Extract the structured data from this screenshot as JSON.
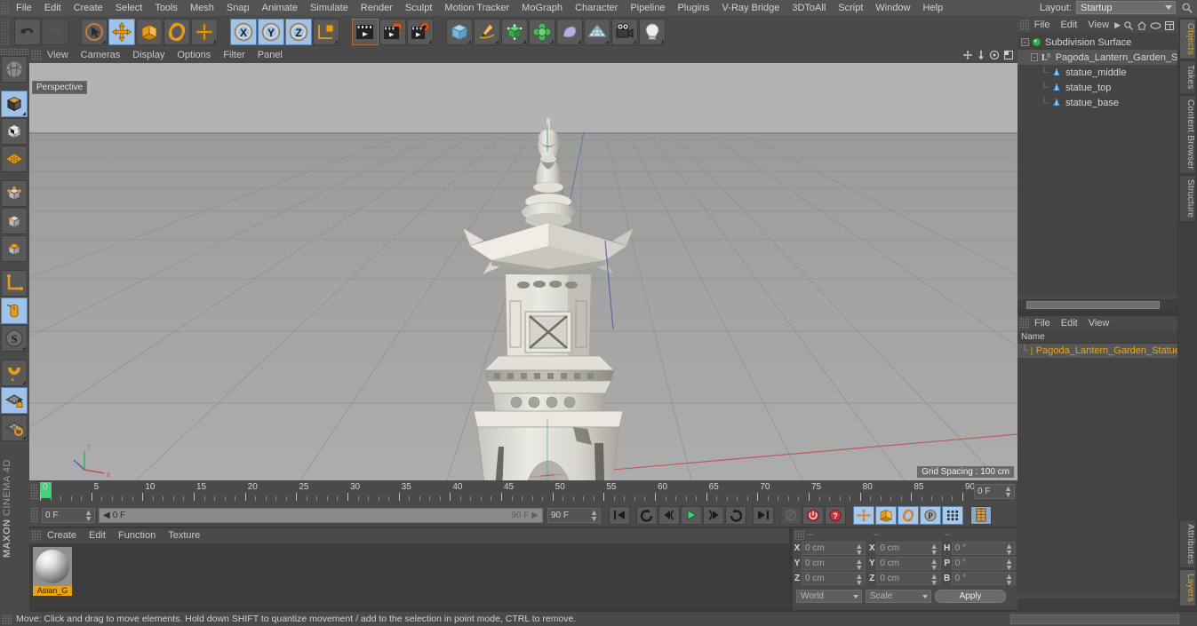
{
  "menubar": {
    "items": [
      "File",
      "Edit",
      "Create",
      "Select",
      "Tools",
      "Mesh",
      "Snap",
      "Animate",
      "Simulate",
      "Render",
      "Sculpt",
      "Motion Tracker",
      "MoGraph",
      "Character",
      "Pipeline",
      "Plugins",
      "V-Ray Bridge",
      "3DToAll",
      "Script",
      "Window",
      "Help"
    ],
    "layout_label": "Layout:",
    "layout_value": "Startup",
    "search_icon": "magnifier-icon"
  },
  "toolbar": {
    "groups": [
      {
        "name": "history",
        "buttons": [
          {
            "name": "undo-button",
            "icon": "undo-arrow-icon",
            "state": "normal"
          },
          {
            "name": "redo-button",
            "icon": "redo-arrow-icon",
            "state": "disabled"
          }
        ]
      },
      {
        "name": "tools",
        "buttons": [
          {
            "name": "live-selection-button",
            "icon": "cursor-circle-icon",
            "state": "normal"
          },
          {
            "name": "move-tool-button",
            "icon": "move-arrows-icon",
            "state": "selected"
          },
          {
            "name": "scale-tool-button",
            "icon": "scale-box-icon",
            "state": "normal"
          },
          {
            "name": "rotate-tool-button",
            "icon": "rotate-ring-icon",
            "state": "normal"
          },
          {
            "name": "transform-tool-button",
            "icon": "plus-cross-icon",
            "state": "normal"
          }
        ]
      },
      {
        "name": "axis-locks",
        "buttons": [
          {
            "name": "x-axis-lock-button",
            "icon": "x-axis-icon",
            "label": "X",
            "state": "selected"
          },
          {
            "name": "y-axis-lock-button",
            "icon": "y-axis-icon",
            "label": "Y",
            "state": "selected"
          },
          {
            "name": "z-axis-lock-button",
            "icon": "z-axis-icon",
            "label": "Z",
            "state": "selected"
          },
          {
            "name": "world-object-axis-button",
            "icon": "axis-cube-icon",
            "state": "normal"
          }
        ]
      },
      {
        "name": "render",
        "buttons": [
          {
            "name": "render-view-button",
            "icon": "clapper-render-icon",
            "state": "active-frame"
          },
          {
            "name": "render-region-button",
            "icon": "clapper-region-icon",
            "state": "normal"
          },
          {
            "name": "render-settings-button",
            "icon": "clapper-settings-icon",
            "state": "normal"
          }
        ]
      },
      {
        "name": "create",
        "buttons": [
          {
            "name": "add-cube-button",
            "icon": "cube-icon",
            "state": "normal"
          },
          {
            "name": "add-spline-button",
            "icon": "pen-spline-icon",
            "state": "normal"
          },
          {
            "name": "add-generator-button",
            "icon": "green-cube-generator-icon",
            "state": "normal"
          },
          {
            "name": "add-array-button",
            "icon": "green-cluster-icon",
            "state": "normal"
          },
          {
            "name": "add-deformer-button",
            "icon": "bend-deformer-icon",
            "state": "normal"
          },
          {
            "name": "add-environment-button",
            "icon": "floor-grid-icon",
            "state": "normal"
          },
          {
            "name": "add-camera-button",
            "icon": "camera-icon",
            "state": "normal"
          },
          {
            "name": "add-light-button",
            "icon": "light-bulb-icon",
            "state": "normal"
          }
        ]
      }
    ]
  },
  "left_toolbar": {
    "buttons": [
      {
        "name": "make-editable-button",
        "icon": "make-editable-icon",
        "state": "normal"
      },
      {
        "name": "model-mode-button",
        "icon": "model-cube-icon",
        "state": "selected"
      },
      {
        "name": "texture-mode-button",
        "icon": "texture-cube-icon",
        "state": "normal"
      },
      {
        "name": "workplane-mode-button",
        "icon": "workplane-grid-icon",
        "state": "normal"
      },
      {
        "name": "points-mode-button",
        "icon": "points-cube-icon",
        "state": "normal"
      },
      {
        "name": "edges-mode-button",
        "icon": "edges-cube-icon",
        "state": "normal"
      },
      {
        "name": "polygons-mode-button",
        "icon": "polygons-cube-icon",
        "state": "normal"
      },
      {
        "name": "object-axis-button",
        "icon": "axis-l-icon",
        "state": "normal"
      },
      {
        "name": "enable-axis-button",
        "icon": "mouse-axis-icon",
        "state": "selected"
      },
      {
        "name": "soft-selection-button",
        "icon": "s-circle-icon",
        "state": "normal"
      },
      {
        "name": "magnet-tool-button",
        "icon": "magnet-icon",
        "state": "normal"
      },
      {
        "name": "lock-workplane-button",
        "icon": "workplane-lock-icon",
        "state": "selected"
      },
      {
        "name": "workplane-rotate-button",
        "icon": "workplane-rotate-icon",
        "state": "normal"
      }
    ],
    "brand_line1": "MAXON",
    "brand_line2": "CINEMA 4D"
  },
  "viewport": {
    "menu_items": [
      "View",
      "Cameras",
      "Display",
      "Options",
      "Filter",
      "Panel"
    ],
    "corner_icons": [
      "pan-icon",
      "zoom-icon",
      "orbit-icon",
      "maximize-icon"
    ],
    "perspective_label": "Perspective",
    "grid_spacing_label": "Grid Spacing : 100 cm",
    "axis_gizmo": {
      "y_label": "Y",
      "x_label": "X"
    },
    "scene_subject": "pagoda lantern garden stone statue"
  },
  "timeline": {
    "tick_labels": [
      "0",
      "5",
      "10",
      "15",
      "20",
      "25",
      "30",
      "35",
      "40",
      "45",
      "50",
      "55",
      "60",
      "65",
      "70",
      "75",
      "80",
      "85",
      "90"
    ],
    "current_frame_field": "0 F",
    "playhead_frame": 0
  },
  "transport": {
    "current_frame": "0 F",
    "range_start": "0 F",
    "range_end": "90 F",
    "end_frame_field": "90 F",
    "buttons": [
      {
        "name": "go-to-start-button",
        "icon": "skip-start-icon",
        "state": "normal"
      },
      {
        "name": "play-backwards-button",
        "icon": "loop-back-icon",
        "state": "normal"
      },
      {
        "name": "previous-frame-button",
        "icon": "step-back-icon",
        "state": "normal"
      },
      {
        "name": "play-button",
        "icon": "play-triangle-icon",
        "state": "normal"
      },
      {
        "name": "next-frame-button",
        "icon": "step-forward-icon",
        "state": "normal"
      },
      {
        "name": "play-forward-loop-button",
        "icon": "loop-forward-icon",
        "state": "normal"
      },
      {
        "name": "go-to-end-button",
        "icon": "skip-end-icon",
        "state": "normal"
      },
      {
        "name": "record-active-objects-button",
        "icon": "keyframe-pencil-icon",
        "state": "disabled"
      },
      {
        "name": "autokeying-button",
        "icon": "record-red-icon",
        "state": "normal"
      },
      {
        "name": "keyframe-selection-button",
        "icon": "question-red-icon",
        "state": "normal"
      },
      {
        "name": "position-key-button",
        "icon": "position-move-icon",
        "state": "selected"
      },
      {
        "name": "scale-key-button",
        "icon": "scale-key-icon",
        "state": "selected"
      },
      {
        "name": "rotation-key-button",
        "icon": "rotation-key-icon",
        "state": "selected"
      },
      {
        "name": "param-key-button",
        "icon": "p-circle-icon",
        "state": "selected"
      },
      {
        "name": "point-level-anim-button",
        "icon": "dot-grid-icon",
        "state": "selected"
      },
      {
        "name": "timeline-view-button",
        "icon": "timeline-strip-icon",
        "state": "normal"
      }
    ]
  },
  "material_manager": {
    "menu_items": [
      "Create",
      "Edit",
      "Function",
      "Texture"
    ],
    "materials": [
      {
        "name": "Asian_G",
        "swatch": "grey-glossy-sphere"
      }
    ]
  },
  "coordinates": {
    "headers": [
      "--",
      "--",
      "--"
    ],
    "position": {
      "label_x": "X",
      "label_y": "Y",
      "label_z": "Z",
      "x": "0 cm",
      "y": "0 cm",
      "z": "0 cm"
    },
    "size": {
      "label_x": "X",
      "label_y": "Y",
      "label_z": "Z",
      "x": "0 cm",
      "y": "0 cm",
      "z": "0 cm"
    },
    "rotation": {
      "label_h": "H",
      "label_p": "P",
      "label_b": "B",
      "h": "0 °",
      "p": "0 °",
      "b": "0 °"
    },
    "system_select": "World",
    "mode_select": "Scale",
    "apply_label": "Apply"
  },
  "object_manager": {
    "menu_items": [
      "File",
      "Edit",
      "View"
    ],
    "header_icons": [
      "chevron-right-icon",
      "search-icon",
      "home-icon",
      "eye-icon",
      "layers-icon"
    ],
    "tree": [
      {
        "name": "Subdivision Surface",
        "icon": "subdivision-surface-icon",
        "depth": 0,
        "selected": false,
        "expander": "-"
      },
      {
        "name": "Pagoda_Lantern_Garden_Statue_",
        "icon": "null-object-icon",
        "depth": 1,
        "selected": true,
        "expander": "-"
      },
      {
        "name": "statue_middle",
        "icon": "polygon-object-icon",
        "depth": 2,
        "selected": false,
        "expander": ""
      },
      {
        "name": "statue_top",
        "icon": "polygon-object-icon",
        "depth": 2,
        "selected": false,
        "expander": ""
      },
      {
        "name": "statue_base",
        "icon": "polygon-object-icon",
        "depth": 2,
        "selected": false,
        "expander": ""
      }
    ]
  },
  "attribute_manager": {
    "menu_items": [
      "File",
      "Edit",
      "View"
    ],
    "column_header": "Name",
    "rows": [
      {
        "name": "Pagoda_Lantern_Garden_Statue_V",
        "swatch_color": "#f0c419"
      }
    ]
  },
  "side_tabs": {
    "top": [
      {
        "label": "Objects",
        "active": true
      },
      {
        "label": "Takes",
        "active": false
      },
      {
        "label": "Content Browser",
        "active": false
      },
      {
        "label": "Structure",
        "active": false
      }
    ],
    "bottom": [
      {
        "label": "Attributes",
        "active": false
      },
      {
        "label": "Layers",
        "active": true
      }
    ]
  },
  "statusbar": {
    "message": "Move: Click and drag to move elements. Hold down SHIFT to quantize movement / add to the selection in point mode, CTRL to remove."
  },
  "colors": {
    "accent_orange": "#e8a317",
    "selection_blue": "#9fc3e8",
    "panel_bg": "#4a4a4a",
    "viewport_bg": "#9d9d9d",
    "green_playhead": "#44d07f"
  }
}
